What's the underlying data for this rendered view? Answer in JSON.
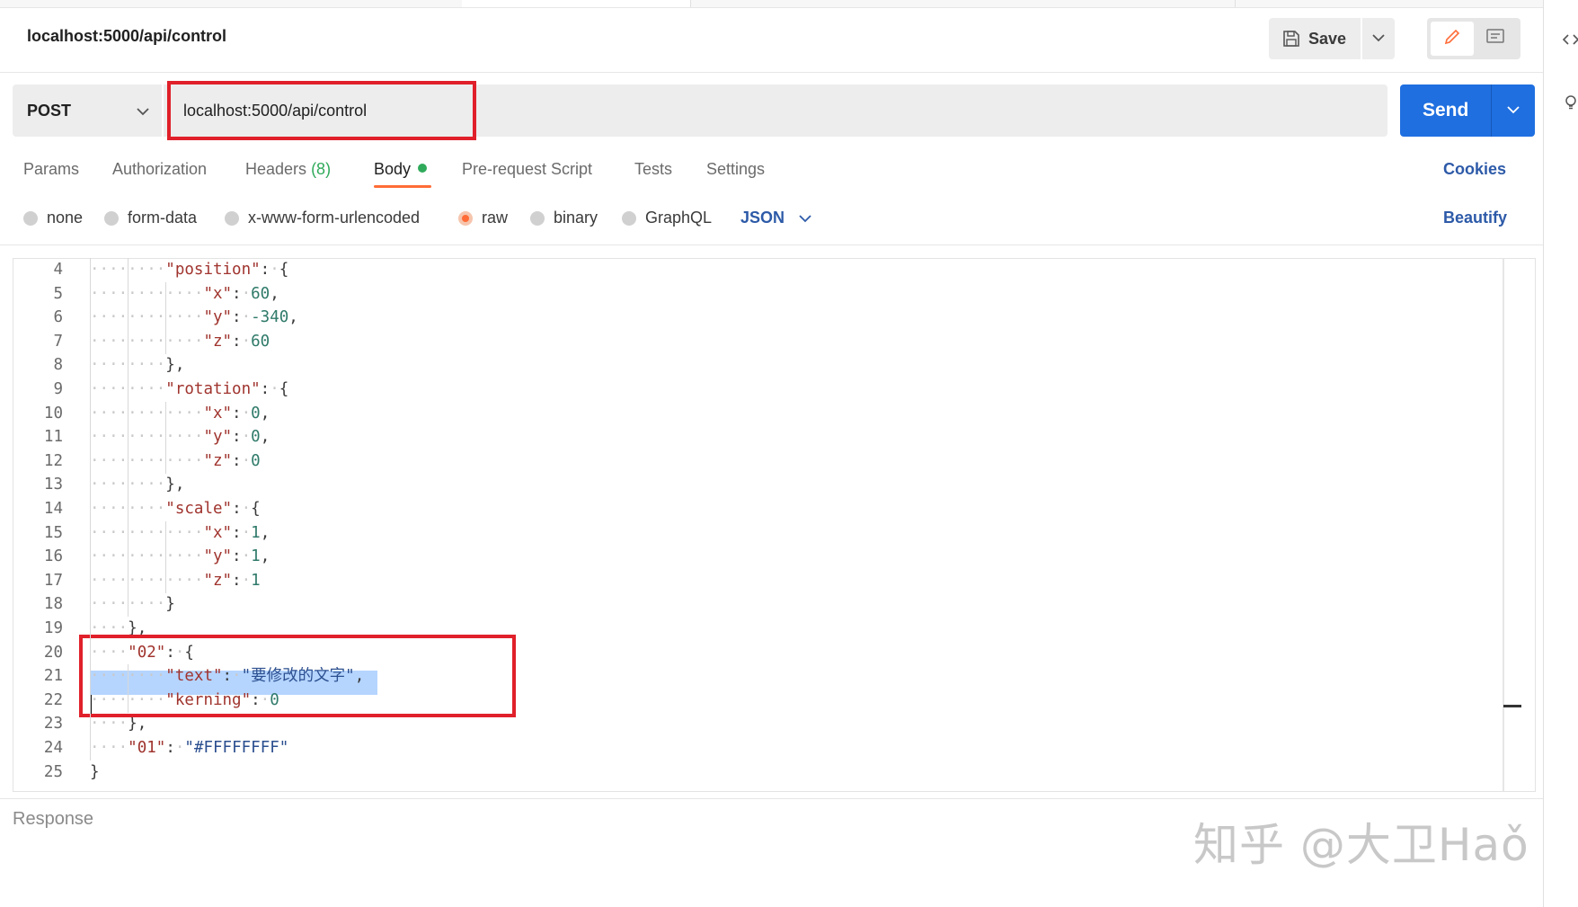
{
  "request": {
    "title": "localhost:5000/api/control",
    "method": "POST",
    "url": "localhost:5000/api/control"
  },
  "toolbar": {
    "save_label": "Save",
    "send_label": "Send"
  },
  "tabs": [
    {
      "label": "Params"
    },
    {
      "label": "Authorization"
    },
    {
      "label": "Headers"
    },
    {
      "label": "Body",
      "active": true
    }
  ],
  "tab_headers_count": "(8)",
  "tabs_more": [
    {
      "label": "Pre-request Script"
    },
    {
      "label": "Tests"
    },
    {
      "label": "Settings"
    }
  ],
  "cookies_label": "Cookies",
  "body_types": [
    {
      "label": "none"
    },
    {
      "label": "form-data"
    },
    {
      "label": "x-www-form-urlencoded"
    },
    {
      "label": "raw",
      "selected": true
    },
    {
      "label": "binary"
    },
    {
      "label": "GraphQL"
    }
  ],
  "raw_format": "JSON",
  "beautify_label": "Beautify",
  "editor": {
    "lines": [
      {
        "n": "4",
        "indent": 2,
        "tokens": [
          [
            "key",
            "\"position\""
          ],
          [
            "pun",
            ":"
          ],
          [
            "ws",
            "·"
          ],
          [
            "pun",
            "{"
          ]
        ]
      },
      {
        "n": "5",
        "indent": 3,
        "tokens": [
          [
            "key",
            "\"x\""
          ],
          [
            "pun",
            ":"
          ],
          [
            "ws",
            "·"
          ],
          [
            "num",
            "60"
          ],
          [
            "pun",
            ","
          ]
        ]
      },
      {
        "n": "6",
        "indent": 3,
        "tokens": [
          [
            "key",
            "\"y\""
          ],
          [
            "pun",
            ":"
          ],
          [
            "ws",
            "·"
          ],
          [
            "num",
            "-340"
          ],
          [
            "pun",
            ","
          ]
        ]
      },
      {
        "n": "7",
        "indent": 3,
        "tokens": [
          [
            "key",
            "\"z\""
          ],
          [
            "pun",
            ":"
          ],
          [
            "ws",
            "·"
          ],
          [
            "num",
            "60"
          ]
        ]
      },
      {
        "n": "8",
        "indent": 2,
        "tokens": [
          [
            "pun",
            "},"
          ]
        ]
      },
      {
        "n": "9",
        "indent": 2,
        "tokens": [
          [
            "key",
            "\"rotation\""
          ],
          [
            "pun",
            ":"
          ],
          [
            "ws",
            "·"
          ],
          [
            "pun",
            "{"
          ]
        ]
      },
      {
        "n": "10",
        "indent": 3,
        "tokens": [
          [
            "key",
            "\"x\""
          ],
          [
            "pun",
            ":"
          ],
          [
            "ws",
            "·"
          ],
          [
            "num",
            "0"
          ],
          [
            "pun",
            ","
          ]
        ]
      },
      {
        "n": "11",
        "indent": 3,
        "tokens": [
          [
            "key",
            "\"y\""
          ],
          [
            "pun",
            ":"
          ],
          [
            "ws",
            "·"
          ],
          [
            "num",
            "0"
          ],
          [
            "pun",
            ","
          ]
        ]
      },
      {
        "n": "12",
        "indent": 3,
        "tokens": [
          [
            "key",
            "\"z\""
          ],
          [
            "pun",
            ":"
          ],
          [
            "ws",
            "·"
          ],
          [
            "num",
            "0"
          ]
        ]
      },
      {
        "n": "13",
        "indent": 2,
        "tokens": [
          [
            "pun",
            "},"
          ]
        ]
      },
      {
        "n": "14",
        "indent": 2,
        "tokens": [
          [
            "key",
            "\"scale\""
          ],
          [
            "pun",
            ":"
          ],
          [
            "ws",
            "·"
          ],
          [
            "pun",
            "{"
          ]
        ]
      },
      {
        "n": "15",
        "indent": 3,
        "tokens": [
          [
            "key",
            "\"x\""
          ],
          [
            "pun",
            ":"
          ],
          [
            "ws",
            "·"
          ],
          [
            "num",
            "1"
          ],
          [
            "pun",
            ","
          ]
        ]
      },
      {
        "n": "16",
        "indent": 3,
        "tokens": [
          [
            "key",
            "\"y\""
          ],
          [
            "pun",
            ":"
          ],
          [
            "ws",
            "·"
          ],
          [
            "num",
            "1"
          ],
          [
            "pun",
            ","
          ]
        ]
      },
      {
        "n": "17",
        "indent": 3,
        "tokens": [
          [
            "key",
            "\"z\""
          ],
          [
            "pun",
            ":"
          ],
          [
            "ws",
            "·"
          ],
          [
            "num",
            "1"
          ]
        ]
      },
      {
        "n": "18",
        "indent": 2,
        "tokens": [
          [
            "pun",
            "}"
          ]
        ]
      },
      {
        "n": "19",
        "indent": 1,
        "tokens": [
          [
            "pun",
            "},"
          ]
        ]
      },
      {
        "n": "20",
        "indent": 1,
        "tokens": [
          [
            "key",
            "\"02\""
          ],
          [
            "pun",
            ":"
          ],
          [
            "ws",
            "·"
          ],
          [
            "pun",
            "{"
          ]
        ]
      },
      {
        "n": "21",
        "indent": 2,
        "tokens": [
          [
            "key",
            "\"text\""
          ],
          [
            "pun",
            ":"
          ],
          [
            "ws",
            "·"
          ],
          [
            "str",
            "\"要修改的文字\""
          ],
          [
            "pun",
            ","
          ]
        ]
      },
      {
        "n": "22",
        "indent": 2,
        "tokens": [
          [
            "key",
            "\"kerning\""
          ],
          [
            "pun",
            ":"
          ],
          [
            "ws",
            "·"
          ],
          [
            "num",
            "0"
          ]
        ]
      },
      {
        "n": "23",
        "indent": 1,
        "tokens": [
          [
            "pun",
            "},"
          ]
        ]
      },
      {
        "n": "24",
        "indent": 1,
        "tokens": [
          [
            "key",
            "\"01\""
          ],
          [
            "pun",
            ":"
          ],
          [
            "ws",
            "·"
          ],
          [
            "str",
            "\"#FFFFFFFF\""
          ]
        ]
      },
      {
        "n": "25",
        "indent": 0,
        "tokens": [
          [
            "pun",
            "}"
          ]
        ]
      }
    ]
  },
  "response_label": "Response",
  "watermark": "知乎 @大卫Haǒ",
  "colors": {
    "accent": "#ff6c37",
    "send": "#1f6fe0",
    "link": "#2d5aa8",
    "highlight_box": "#e0202a"
  },
  "icons": [
    "save-icon",
    "chevron-down-icon",
    "pencil-icon",
    "comment-icon",
    "code-icon",
    "lightbulb-icon"
  ]
}
